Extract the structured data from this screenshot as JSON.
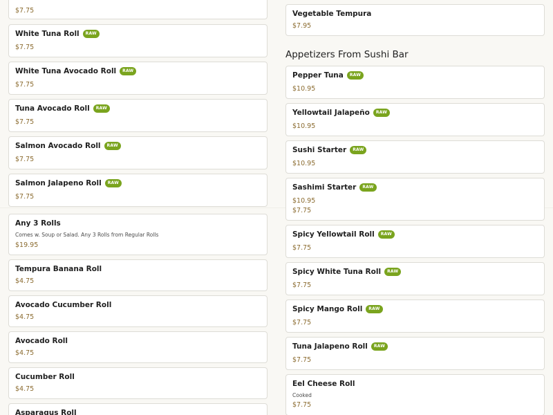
{
  "left_column": {
    "items": [
      {
        "name": "",
        "price": "$7.75",
        "raw": true
      },
      {
        "name": "White Tuna Roll",
        "price": "$7.75",
        "raw": true
      },
      {
        "name": "White Tuna Avocado Roll",
        "price": "$7.75",
        "raw": true
      },
      {
        "name": "Tuna Avocado Roll",
        "price": "$7.75",
        "raw": true
      },
      {
        "name": "Salmon Avocado Roll",
        "price": "$7.75",
        "raw": true
      },
      {
        "name": "Salmon Jalapeno Roll",
        "price": "$7.75",
        "raw": true
      },
      {
        "name": "Any 3 Rolls",
        "description": "Comes w. Soup or Salad. Any 3 Rolls from Regular Rolls",
        "price": "$19.95",
        "raw": false
      },
      {
        "name": "Tempura Banana Roll",
        "price": "$4.75",
        "raw": false
      },
      {
        "name": "Avocado Cucumber Roll",
        "price": "$4.75",
        "raw": false
      },
      {
        "name": "Avocado Roll",
        "price": "$4.75",
        "raw": false
      },
      {
        "name": "Cucumber Roll",
        "price": "$4.75",
        "raw": false
      },
      {
        "name": "Asparagus Roll",
        "price": "",
        "raw": false
      }
    ]
  },
  "right_column": {
    "top_item": {
      "name": "Vegetable Tempura",
      "price": "$7.95"
    },
    "section_title": "Appetizers From Sushi Bar",
    "items": [
      {
        "name": "Pepper Tuna",
        "price": "$10.95",
        "raw": true
      },
      {
        "name": "Yellowtail Jalapeño",
        "price": "$10.95",
        "raw": true
      },
      {
        "name": "Sushi Starter",
        "price": "$10.95",
        "raw": true
      },
      {
        "name": "Sashimi Starter",
        "price": "$10.95",
        "raw": true
      },
      {
        "name": "",
        "price": "$7.75",
        "raw": false
      },
      {
        "name": "Spicy Yellowtail Roll",
        "price": "$7.75",
        "raw": true
      },
      {
        "name": "Spicy White Tuna Roll",
        "price": "$7.75",
        "raw": true
      },
      {
        "name": "Spicy Mango Roll",
        "price": "$7.75",
        "raw": true
      },
      {
        "name": "Tuna Jalapeno Roll",
        "price": "$7.75",
        "raw": true
      },
      {
        "name": "Eel Cheese Roll",
        "description": "Cooked",
        "price": "$7.75",
        "raw": false
      }
    ]
  },
  "badge_label": "RAW",
  "colors": {
    "badge": "#7aa41e",
    "price": "#8a6a2e",
    "card_border": "#dddcd6",
    "background": "#f9f8f4"
  }
}
